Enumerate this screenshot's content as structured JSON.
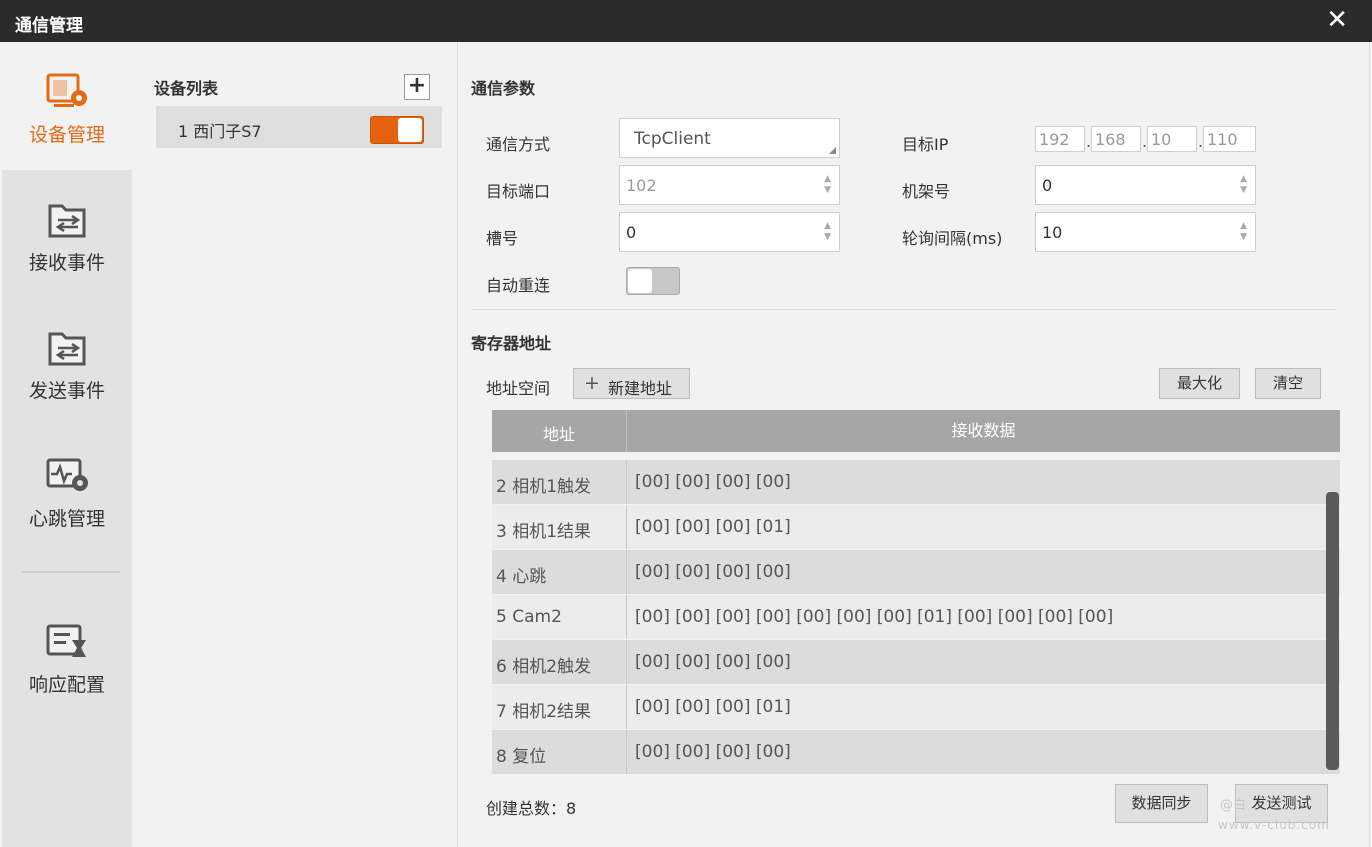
{
  "window": {
    "title": "通信管理",
    "close": "✕"
  },
  "nav": {
    "items": [
      {
        "label": "设备管理",
        "icon": "device-settings-icon",
        "active": true
      },
      {
        "label": "接收事件",
        "icon": "receive-folder-icon"
      },
      {
        "label": "发送事件",
        "icon": "send-folder-icon"
      },
      {
        "label": "心跳管理",
        "icon": "heartbeat-settings-icon"
      },
      {
        "label": "响应配置",
        "icon": "hourglass-list-icon"
      }
    ]
  },
  "devices": {
    "title": "设备列表",
    "add": "+",
    "items": [
      {
        "label": "1 西门子S7",
        "enabled": true
      }
    ]
  },
  "params": {
    "title": "通信参数",
    "mode_label": "通信方式",
    "mode_value": "TcpClient",
    "ip_label": "目标IP",
    "ip": [
      "192",
      "168",
      "10",
      "110"
    ],
    "port_label": "目标端口",
    "port_value": "102",
    "rack_label": "机架号",
    "rack_value": "0",
    "slot_label": "槽号",
    "slot_value": "0",
    "poll_label": "轮询间隔(ms)",
    "poll_value": "10",
    "reconnect_label": "自动重连",
    "reconnect_on": false
  },
  "registers": {
    "title": "寄存器地址",
    "space_label": "地址空间",
    "new_label": "新建地址",
    "maximize_label": "最大化",
    "clear_label": "清空",
    "col_address": "地址",
    "col_data": "接收数据",
    "rows": [
      {
        "address": "2 相机1触发",
        "data": "[00] [00] [00] [00]"
      },
      {
        "address": "3 相机1结果",
        "data": "[00] [00] [00] [01]"
      },
      {
        "address": "4 心跳",
        "data": "[00] [00] [00] [00]"
      },
      {
        "address": "5 Cam2",
        "data": "[00] [00] [00] [00] [00] [00] [00] [01] [00] [00] [00] [00]"
      },
      {
        "address": "6 相机2触发",
        "data": "[00] [00] [00] [00]"
      },
      {
        "address": "7 相机2结果",
        "data": "[00] [00] [00] [01]"
      },
      {
        "address": "8 复位",
        "data": "[00] [00] [00] [00]"
      }
    ]
  },
  "footer": {
    "count_label": "创建总数：",
    "count_value": "8",
    "sync_label": "数据同步",
    "test_label": "发送测试"
  },
  "watermark": {
    "handle": "@白",
    "site": "www.v-club.com"
  }
}
